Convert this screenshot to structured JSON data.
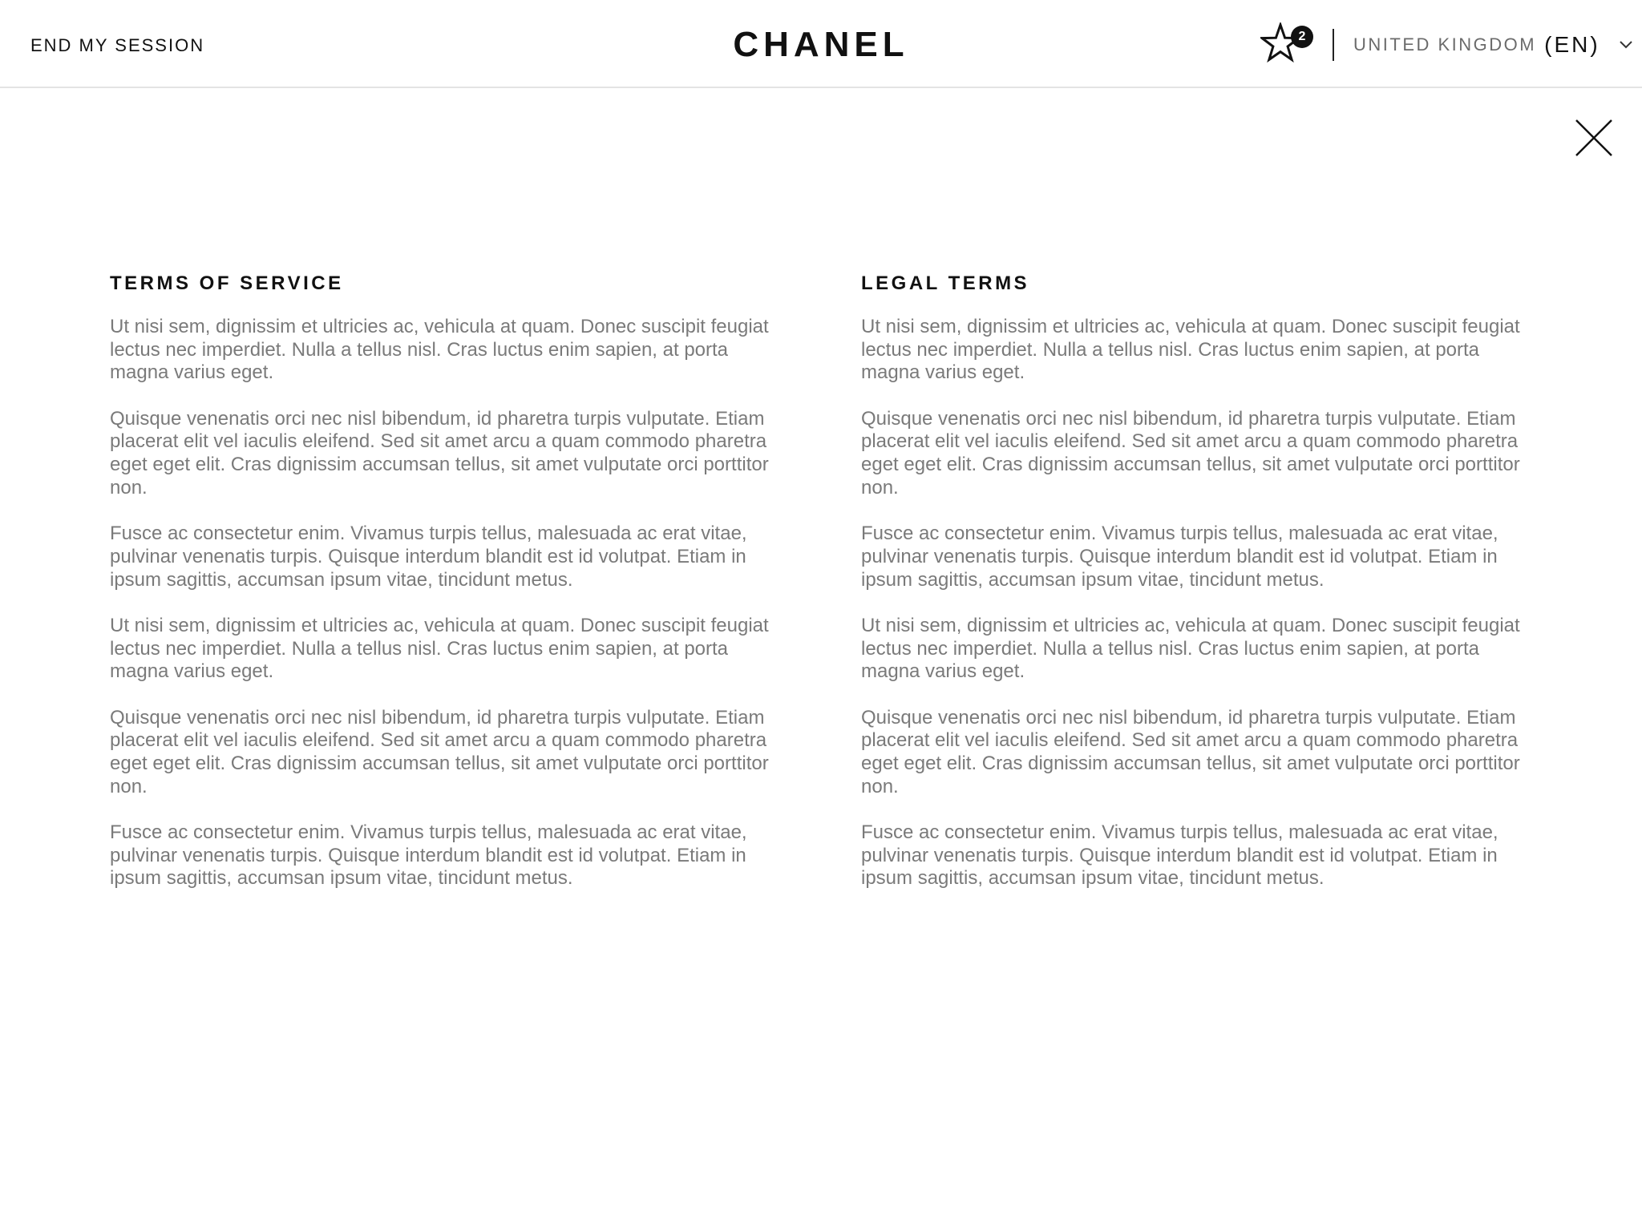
{
  "header": {
    "end_session_label": "END MY SESSION",
    "brand": "CHANEL",
    "wishlist": {
      "icon": "star-icon",
      "count": "2"
    },
    "region": {
      "country": "UNITED KINGDOM",
      "language": "(EN)",
      "icon": "chevron-down-icon"
    }
  },
  "close": {
    "icon": "close-icon"
  },
  "sections": [
    {
      "title": "TERMS OF SERVICE",
      "paragraphs": [
        "Ut nisi sem, dignissim et ultricies ac, vehicula at quam. Donec suscipit feugiat lectus nec imperdiet. Nulla a tellus nisl. Cras luctus enim sapien, at porta magna varius eget.",
        "Quisque venenatis orci nec nisl bibendum, id pharetra turpis vulputate. Etiam placerat elit vel iaculis eleifend. Sed sit amet arcu a quam commodo pharetra eget eget elit. Cras dignissim accumsan tellus, sit amet vulputate orci porttitor non.",
        "Fusce ac consectetur enim. Vivamus turpis tellus, malesuada ac erat vitae, pulvinar venenatis turpis. Quisque interdum blandit est id volutpat. Etiam in ipsum sagittis, accumsan ipsum vitae, tincidunt metus.",
        "Ut nisi sem, dignissim et ultricies ac, vehicula at quam. Donec suscipit feugiat lectus nec imperdiet. Nulla a tellus nisl. Cras luctus enim sapien, at porta magna varius eget.",
        "Quisque venenatis orci nec nisl bibendum, id pharetra turpis vulputate. Etiam placerat elit vel iaculis eleifend. Sed sit amet arcu a quam commodo pharetra eget eget elit. Cras dignissim accumsan tellus, sit amet vulputate orci porttitor non.",
        "Fusce ac consectetur enim. Vivamus turpis tellus, malesuada ac erat vitae, pulvinar venenatis turpis. Quisque interdum blandit est id volutpat. Etiam in ipsum sagittis, accumsan ipsum vitae, tincidunt metus."
      ]
    },
    {
      "title": "LEGAL TERMS",
      "paragraphs": [
        "Ut nisi sem, dignissim et ultricies ac, vehicula at quam. Donec suscipit feugiat lectus nec imperdiet. Nulla a tellus nisl. Cras luctus enim sapien, at porta magna varius eget.",
        "Quisque venenatis orci nec nisl bibendum, id pharetra turpis vulputate. Etiam placerat elit vel iaculis eleifend. Sed sit amet arcu a quam commodo pharetra eget eget elit. Cras dignissim accumsan tellus, sit amet vulputate orci porttitor non.",
        "Fusce ac consectetur enim. Vivamus turpis tellus, malesuada ac erat vitae, pulvinar venenatis turpis. Quisque interdum blandit est id volutpat. Etiam in ipsum sagittis, accumsan ipsum vitae, tincidunt metus.",
        "Ut nisi sem, dignissim et ultricies ac, vehicula at quam. Donec suscipit feugiat lectus nec imperdiet. Nulla a tellus nisl. Cras luctus enim sapien, at porta magna varius eget.",
        "Quisque venenatis orci nec nisl bibendum, id pharetra turpis vulputate. Etiam placerat elit vel iaculis eleifend. Sed sit amet arcu a quam commodo pharetra eget eget elit. Cras dignissim accumsan tellus, sit amet vulputate orci porttitor non.",
        "Fusce ac consectetur enim. Vivamus turpis tellus, malesuada ac erat vitae, pulvinar venenatis turpis. Quisque interdum blandit est id volutpat. Etiam in ipsum sagittis, accumsan ipsum vitae, tincidunt metus."
      ]
    }
  ]
}
